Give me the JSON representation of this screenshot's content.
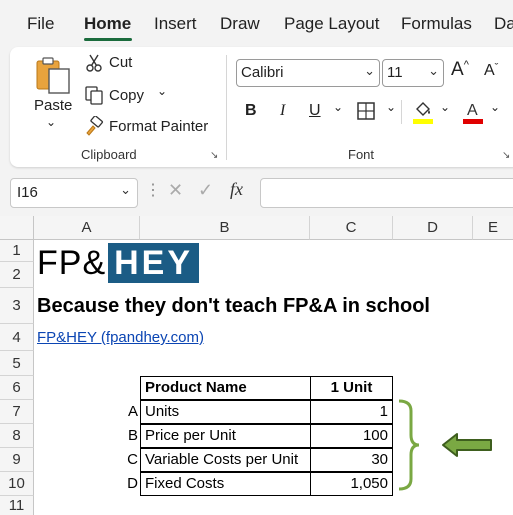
{
  "menu": {
    "tabs": [
      "File",
      "Home",
      "Insert",
      "Draw",
      "Page Layout",
      "Formulas",
      "Da"
    ],
    "active": "Home"
  },
  "ribbon": {
    "clipboard": {
      "paste_label": "Paste",
      "cut_label": "Cut",
      "copy_label": "Copy",
      "format_painter_label": "Format Painter",
      "group_label": "Clipboard"
    },
    "font": {
      "font_name": "Calibri",
      "font_size": "11",
      "bold": "B",
      "italic": "I",
      "underline": "U",
      "group_label": "Font",
      "highlight_color": "#ffff00",
      "font_color": "#e00000"
    }
  },
  "formula_bar": {
    "name_box": "I16",
    "fx_label": "fx",
    "value": ""
  },
  "grid": {
    "columns": [
      "A",
      "B",
      "C",
      "D",
      "E"
    ],
    "rows": [
      "1",
      "2",
      "3",
      "4",
      "5",
      "6",
      "7",
      "8",
      "9",
      "10",
      "11"
    ],
    "logo": {
      "left": "FP&",
      "right": "HEY",
      "box_color": "#1b5c85"
    },
    "tagline": "Because they don't teach FP&A in school",
    "link": "FP&HEY (fpandhey.com)",
    "table": {
      "headers": [
        "Product Name",
        "1 Unit"
      ],
      "rows": [
        {
          "letter": "A",
          "name": "Units",
          "value": "1"
        },
        {
          "letter": "B",
          "name": "Price per Unit",
          "value": "100"
        },
        {
          "letter": "C",
          "name": "Variable Costs per Unit",
          "value": "30"
        },
        {
          "letter": "D",
          "name": "Fixed Costs",
          "value": "1,050"
        }
      ]
    },
    "annotation_color": "#7aa843"
  }
}
